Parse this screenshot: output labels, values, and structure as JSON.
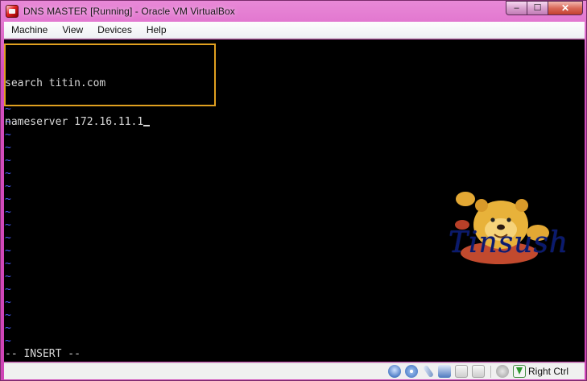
{
  "window": {
    "title": "DNS MASTER [Running] - Oracle VM VirtualBox",
    "controls": {
      "minimize": "–",
      "maximize": "☐",
      "close": "✕"
    }
  },
  "menubar": {
    "items": [
      {
        "label": "Machine"
      },
      {
        "label": "View"
      },
      {
        "label": "Devices"
      },
      {
        "label": "Help"
      }
    ]
  },
  "terminal": {
    "lines": [
      "search titin.com",
      "nameserver 172.16.11.1"
    ],
    "tilde_rows": 20,
    "mode": "-- INSERT --",
    "colors": {
      "text": "#d8d8d8",
      "tilde": "#4a5cff",
      "highlight": "#e0a020"
    }
  },
  "wallpaper": {
    "watermark": "Tinsush"
  },
  "statusbar": {
    "icons": [
      "hard-disk-icon",
      "optical-drive-icon",
      "usb-icon",
      "network-icon",
      "shared-folder-icon",
      "display-icon",
      "capture-icon",
      "host-key-arrow-icon"
    ],
    "host_key": "Right Ctrl"
  }
}
